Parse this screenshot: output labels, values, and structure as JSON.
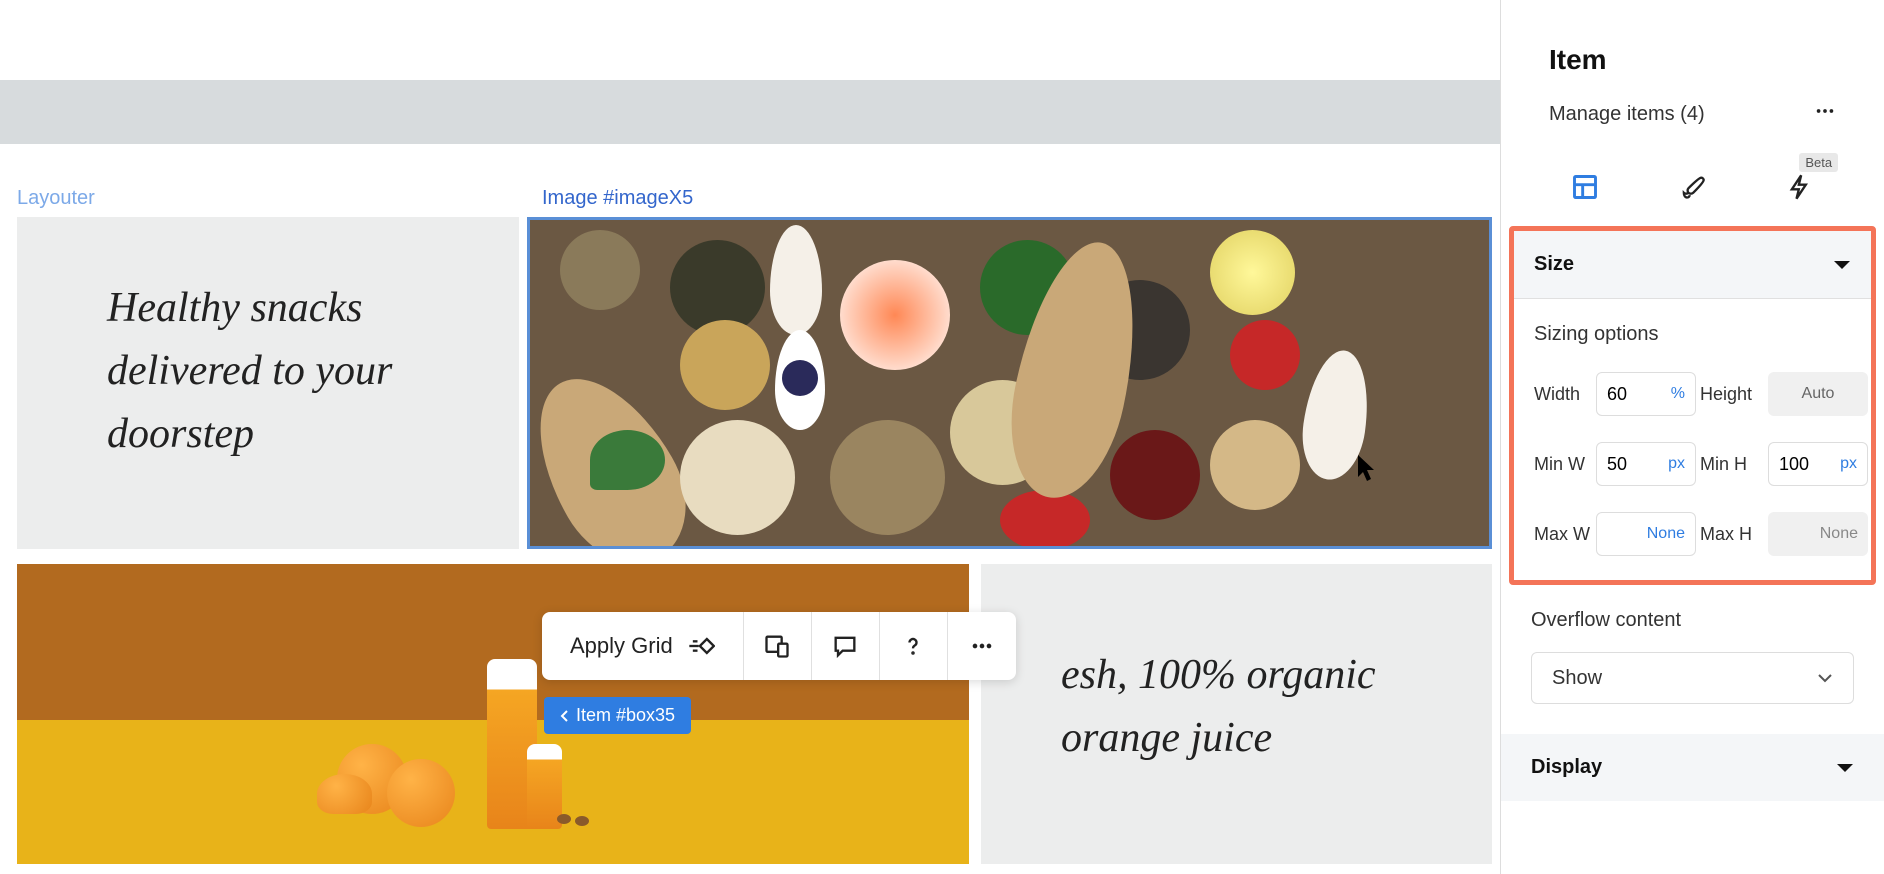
{
  "canvas": {
    "layouter_label": "Layouter",
    "image_label": "Image #imageX5",
    "text1": "Healthy snacks delivered to your doorstep",
    "text2": "esh, 100% organic orange juice",
    "item_badge": "Item #box35"
  },
  "toolbar": {
    "apply_grid": "Apply Grid"
  },
  "panel": {
    "title": "Item",
    "manage_items": "Manage items (4)",
    "beta": "Beta",
    "size_section": "Size",
    "sizing_options": "Sizing options",
    "width_label": "Width",
    "width_value": "60",
    "width_unit": "%",
    "height_label": "Height",
    "height_value": "Auto",
    "minw_label": "Min W",
    "minw_value": "50",
    "minw_unit": "px",
    "minh_label": "Min H",
    "minh_value": "100",
    "minh_unit": "px",
    "maxw_label": "Max W",
    "maxw_value": "None",
    "maxh_label": "Max H",
    "maxh_value": "None",
    "overflow_label": "Overflow content",
    "overflow_value": "Show",
    "display_section": "Display"
  }
}
